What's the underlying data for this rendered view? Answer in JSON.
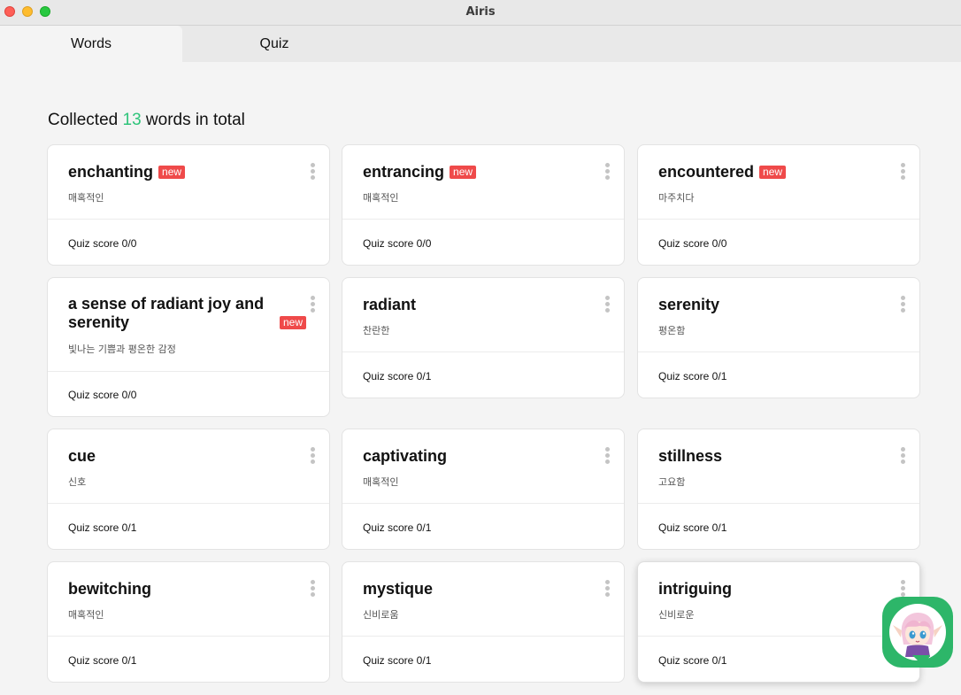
{
  "window": {
    "title": "Airis"
  },
  "tabs": [
    {
      "label": "Words"
    },
    {
      "label": "Quiz"
    }
  ],
  "header": {
    "prefix": "Collected ",
    "count": "13",
    "suffix": " words in total"
  },
  "new_badge": "new",
  "cards": [
    {
      "word": "enchanting",
      "meaning": "매혹적인",
      "score": "Quiz score 0/0",
      "is_new": true
    },
    {
      "word": "entrancing",
      "meaning": "매혹적인",
      "score": "Quiz score 0/0",
      "is_new": true
    },
    {
      "word": "encountered",
      "meaning": "마주치다",
      "score": "Quiz score 0/0",
      "is_new": true
    },
    {
      "word": "a sense of radiant joy and serenity",
      "meaning": "빛나는 기쁨과 평온한 감정",
      "score": "Quiz score 0/0",
      "is_new": true
    },
    {
      "word": "radiant",
      "meaning": "찬란한",
      "score": "Quiz score 0/1",
      "is_new": false
    },
    {
      "word": "serenity",
      "meaning": "평온함",
      "score": "Quiz score 0/1",
      "is_new": false
    },
    {
      "word": "cue",
      "meaning": "신호",
      "score": "Quiz score 0/1",
      "is_new": false
    },
    {
      "word": "captivating",
      "meaning": "매혹적인",
      "score": "Quiz score 0/1",
      "is_new": false
    },
    {
      "word": "stillness",
      "meaning": "고요함",
      "score": "Quiz score 0/1",
      "is_new": false
    },
    {
      "word": "bewitching",
      "meaning": "매혹적인",
      "score": "Quiz score 0/1",
      "is_new": false
    },
    {
      "word": "mystique",
      "meaning": "신비로움",
      "score": "Quiz score 0/1",
      "is_new": false
    },
    {
      "word": "intriguing",
      "meaning": "신비로운",
      "score": "Quiz score 0/1",
      "is_new": false
    }
  ],
  "colors": {
    "accent_green": "#2ec47a",
    "badge_red": "#ef4a4a",
    "assistant_green": "#2db669"
  },
  "icons": {
    "card_menu": "kebab-icon",
    "assistant": "assistant-avatar-icon"
  }
}
